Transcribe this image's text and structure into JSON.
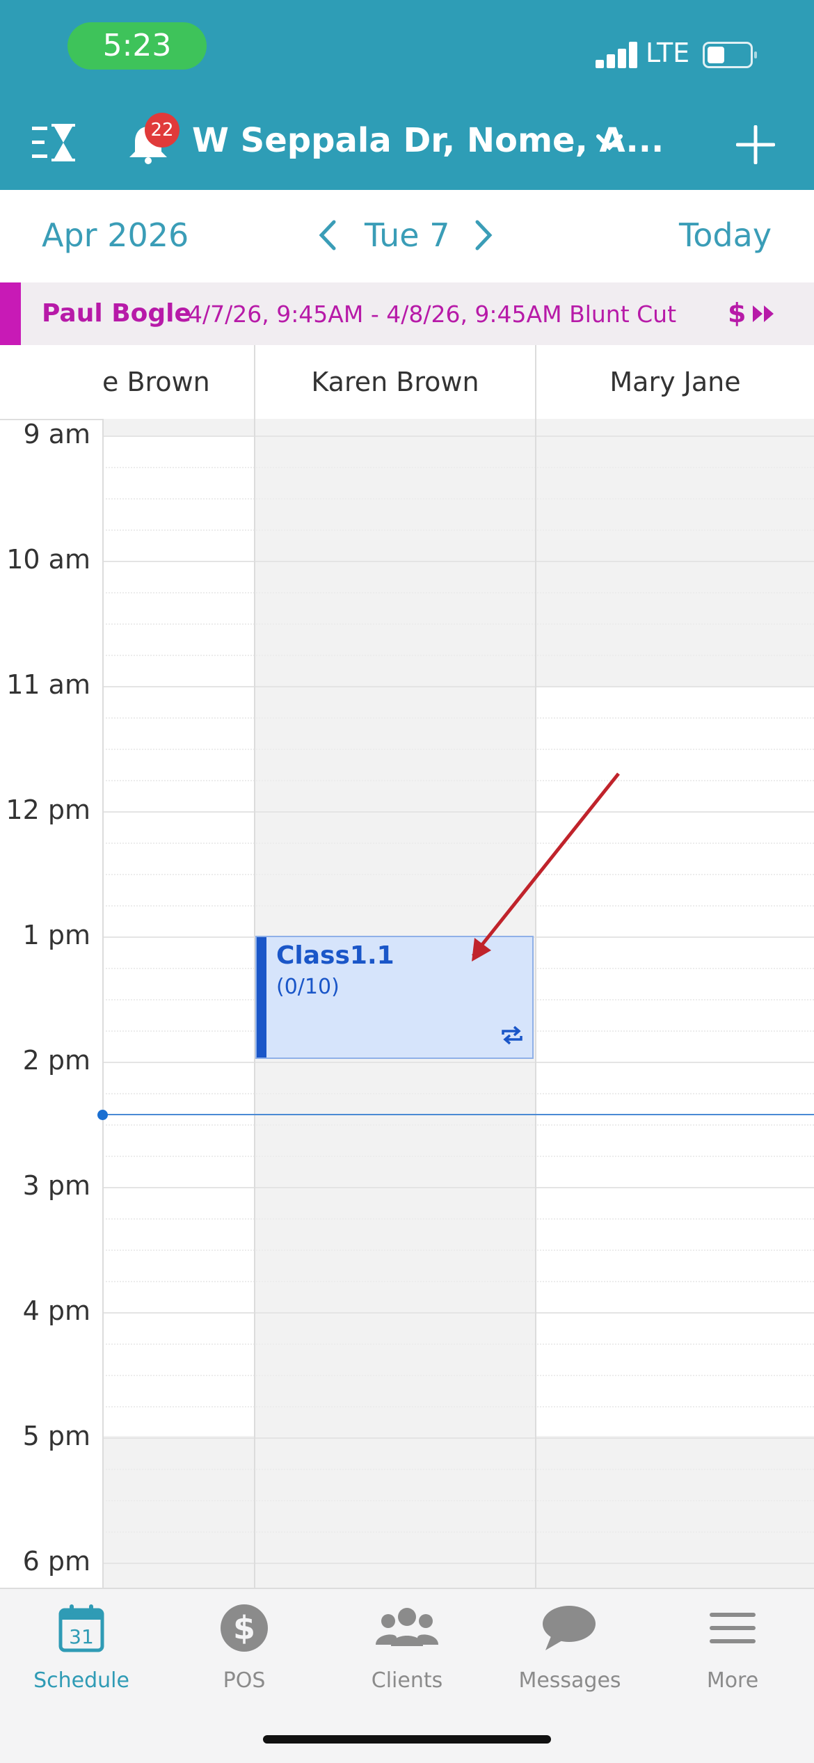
{
  "status_bar": {
    "time": "5:23",
    "network": "LTE"
  },
  "header": {
    "notification_count": "22",
    "location": "W Seppala Dr, Nome, A..."
  },
  "date_nav": {
    "month": "Apr 2026",
    "day": "Tue 7",
    "today_label": "Today"
  },
  "appointment_banner": {
    "client_name": "Paul Bogle",
    "details": "4/7/26, 9:45AM - 4/8/26, 9:45AM Blunt Cut",
    "pay_symbol": "$"
  },
  "staff": [
    "e Brown",
    "Karen Brown",
    "Mary Jane"
  ],
  "hours": [
    "9 am",
    "10 am",
    "11 am",
    "12 pm",
    "1 pm",
    "2 pm",
    "3 pm",
    "4 pm",
    "5 pm",
    "6 pm"
  ],
  "class_event": {
    "title": "Class1.1",
    "count": "(0/10)"
  },
  "tabs": [
    {
      "label": "Schedule",
      "icon": "calendar-icon",
      "active": true,
      "icon_text": "31"
    },
    {
      "label": "POS",
      "icon": "dollar-icon",
      "active": false
    },
    {
      "label": "Clients",
      "icon": "clients-icon",
      "active": false
    },
    {
      "label": "Messages",
      "icon": "chat-icon",
      "active": false
    },
    {
      "label": "More",
      "icon": "hamburger-icon",
      "active": false
    }
  ],
  "colors": {
    "header": "#2e9db6",
    "accent": "#3a9db7",
    "appointment": "#b71aa8",
    "class_block": "#d6e4fb",
    "class_text": "#1a56c8",
    "annotation": "#c0232b"
  }
}
